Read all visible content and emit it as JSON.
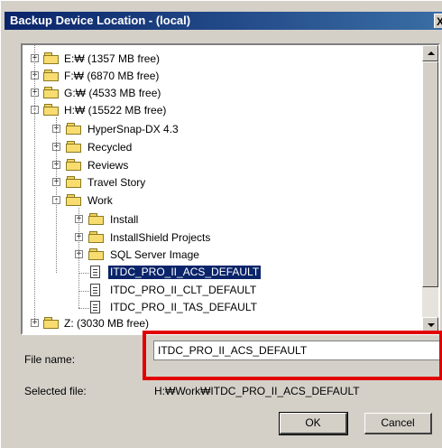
{
  "window": {
    "title": "Backup Device Location - (local)",
    "close_glyph": "X"
  },
  "tree": {
    "items": [
      {
        "label": "E:₩ (1357 MB free)",
        "type": "drive",
        "expander": "+"
      },
      {
        "label": "F:₩ (6870 MB free)",
        "type": "drive",
        "expander": "+"
      },
      {
        "label": "G:₩ (4533 MB free)",
        "type": "drive",
        "expander": "+"
      },
      {
        "label": "H:₩ (15522 MB free)",
        "type": "drive",
        "expander": "-"
      },
      {
        "label": "HyperSnap-DX 4.3",
        "type": "folder",
        "expander": "+"
      },
      {
        "label": "Recycled",
        "type": "folder",
        "expander": "+"
      },
      {
        "label": "Reviews",
        "type": "folder",
        "expander": "+"
      },
      {
        "label": "Travel Story",
        "type": "folder",
        "expander": "+"
      },
      {
        "label": "Work",
        "type": "folder",
        "expander": "-"
      },
      {
        "label": "Install",
        "type": "folder",
        "expander": "+"
      },
      {
        "label": "InstallShield Projects",
        "type": "folder",
        "expander": "+"
      },
      {
        "label": "SQL Server Image",
        "type": "folder",
        "expander": "+"
      },
      {
        "label": "ITDC_PRO_II_ACS_DEFAULT",
        "type": "file",
        "selected": true
      },
      {
        "label": "ITDC_PRO_II_CLT_DEFAULT",
        "type": "file"
      },
      {
        "label": "ITDC_PRO_II_TAS_DEFAULT",
        "type": "file"
      },
      {
        "label": "Z: (3030 MB free)",
        "type": "drive",
        "expander": "+"
      }
    ]
  },
  "form": {
    "file_name_label": "File name:",
    "file_name_value": "ITDC_PRO_II_ACS_DEFAULT",
    "selected_file_label": "Selected file:",
    "selected_file_value": "H:₩Work₩ITDC_PRO_II_ACS_DEFAULT"
  },
  "buttons": {
    "ok": "OK",
    "cancel": "Cancel"
  },
  "colors": {
    "titlebar": "#0a246a",
    "highlight": "#e10000",
    "selection": "#0a246a"
  }
}
